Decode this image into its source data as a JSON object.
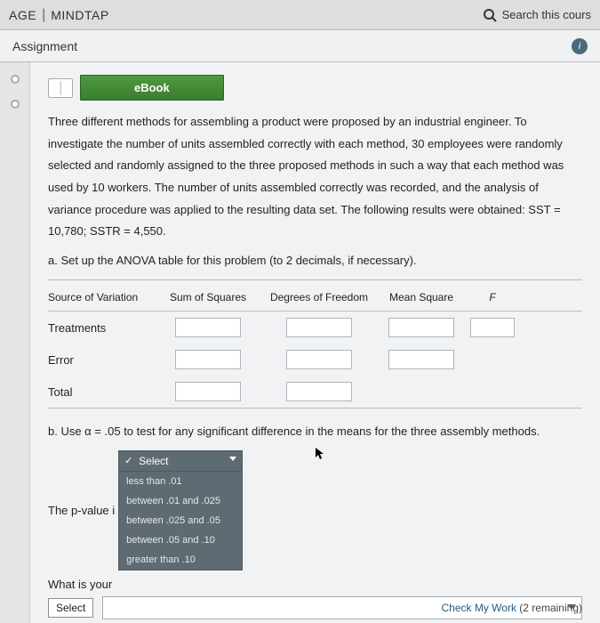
{
  "header": {
    "brand1": "AGE",
    "brand2": "MINDTAP",
    "search_placeholder": "Search this cours"
  },
  "subheader": {
    "title": "Assignment"
  },
  "ebook": {
    "label": "eBook"
  },
  "question": {
    "text": "Three different methods for assembling a product were proposed by an industrial engineer. To investigate the number of units assembled correctly with each method, 30 employees were randomly selected and randomly assigned to the three proposed methods in such a way that each method was used by 10 workers. The number of units assembled correctly was recorded, and the analysis of variance procedure was applied to the resulting data set. The following results were obtained: SST = 10,780; SSTR = 4,550.",
    "part_a": "a. Set up the ANOVA table for this problem (to 2 decimals, if necessary)."
  },
  "anova": {
    "headers": {
      "c1": "Source of Variation",
      "c2": "Sum of Squares",
      "c3": "Degrees of Freedom",
      "c4": "Mean Square",
      "c5": "F"
    },
    "rows": {
      "r1": "Treatments",
      "r2": "Error",
      "r3": "Total"
    }
  },
  "part_b": "b. Use α = .05 to test for any significant difference in the means for the three assembly methods.",
  "pvalue": {
    "label": "The p-value i",
    "selected": "Select",
    "options": [
      "less than .01",
      "between .01 and .025",
      "between .025 and .05",
      "between .05 and .10",
      "greater than .10"
    ]
  },
  "conclusion": {
    "label": "What is your",
    "select_label": "Select"
  },
  "footer": {
    "check": "Check My Work",
    "remaining": "(2 remaining)"
  }
}
